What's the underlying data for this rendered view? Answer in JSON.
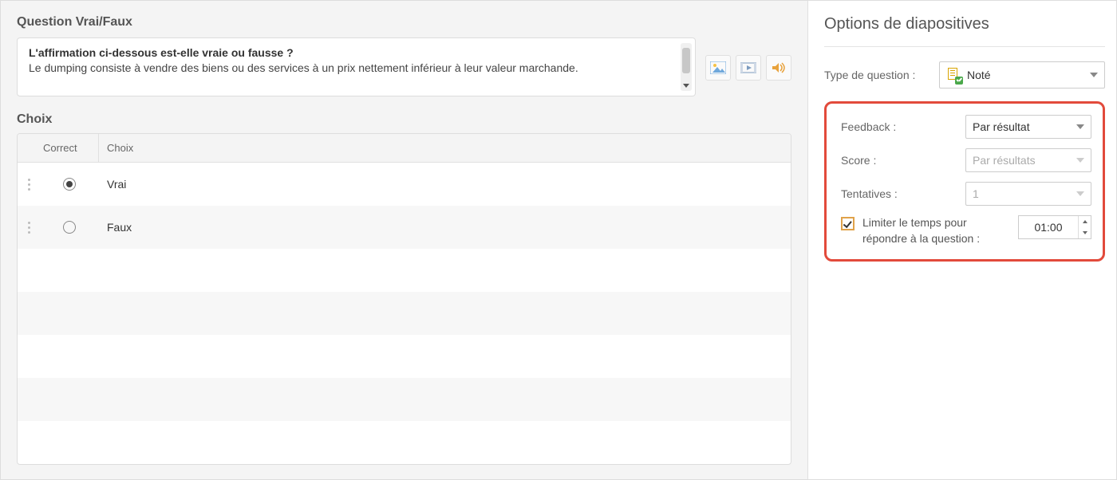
{
  "main": {
    "question_title": "Question Vrai/Faux",
    "question_prompt": "L'affirmation ci-dessous est-elle vraie ou fausse ?",
    "question_body": "Le dumping consiste à vendre des biens ou des services à un prix nettement inférieur à leur valeur marchande.",
    "choices_title": "Choix",
    "columns": {
      "correct": "Correct",
      "choice": "Choix"
    },
    "choices": [
      {
        "label": "Vrai",
        "correct": true
      },
      {
        "label": "Faux",
        "correct": false
      }
    ],
    "media_icons": {
      "image": "image-icon",
      "video": "video-icon",
      "audio": "audio-icon"
    }
  },
  "panel": {
    "title": "Options de diapositives",
    "type_label": "Type de question :",
    "type_value": "Noté",
    "feedback_label": "Feedback :",
    "feedback_value": "Par résultat",
    "score_label": "Score :",
    "score_value": "Par résultats",
    "attempts_label": "Tentatives :",
    "attempts_value": "1",
    "limit_label": "Limiter le temps pour répondre à la question :",
    "limit_checked": true,
    "limit_value": "01:00"
  }
}
